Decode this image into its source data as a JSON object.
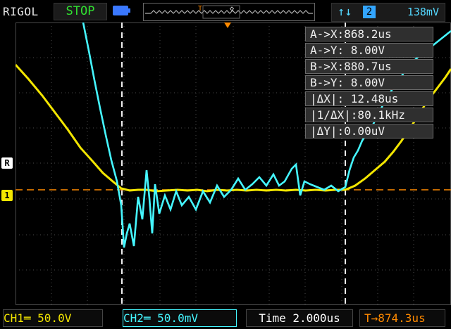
{
  "top": {
    "brand": "RIGOL",
    "status": "STOP",
    "trigger_symbol": "↑↓",
    "trigger_source": "2",
    "trigger_level": "138mV"
  },
  "markers": {
    "trigger_t": "T",
    "ref_r": "R",
    "ch_marker": "1"
  },
  "cursor_panel": {
    "rows": [
      "A->X:868.2us",
      "A->Y: 8.00V",
      "B->X:880.7us",
      "B->Y: 8.00V",
      "|ΔX|: 12.48us",
      "|1/ΔX|:80.1kHz",
      "|ΔY|:0.00uV"
    ]
  },
  "bottom": {
    "ch1": "CH1═ 50.0V",
    "ch2": "CH2═ 50.0mV",
    "time": "Time 2.000us",
    "trigger_time": "T→874.3us"
  },
  "colors": {
    "ch1": "#f3e600",
    "ch2": "#45f6ff",
    "grid": "#4a4a4a",
    "cursor_line": "#f0f0f0",
    "trigger": "#ff8a00"
  }
}
